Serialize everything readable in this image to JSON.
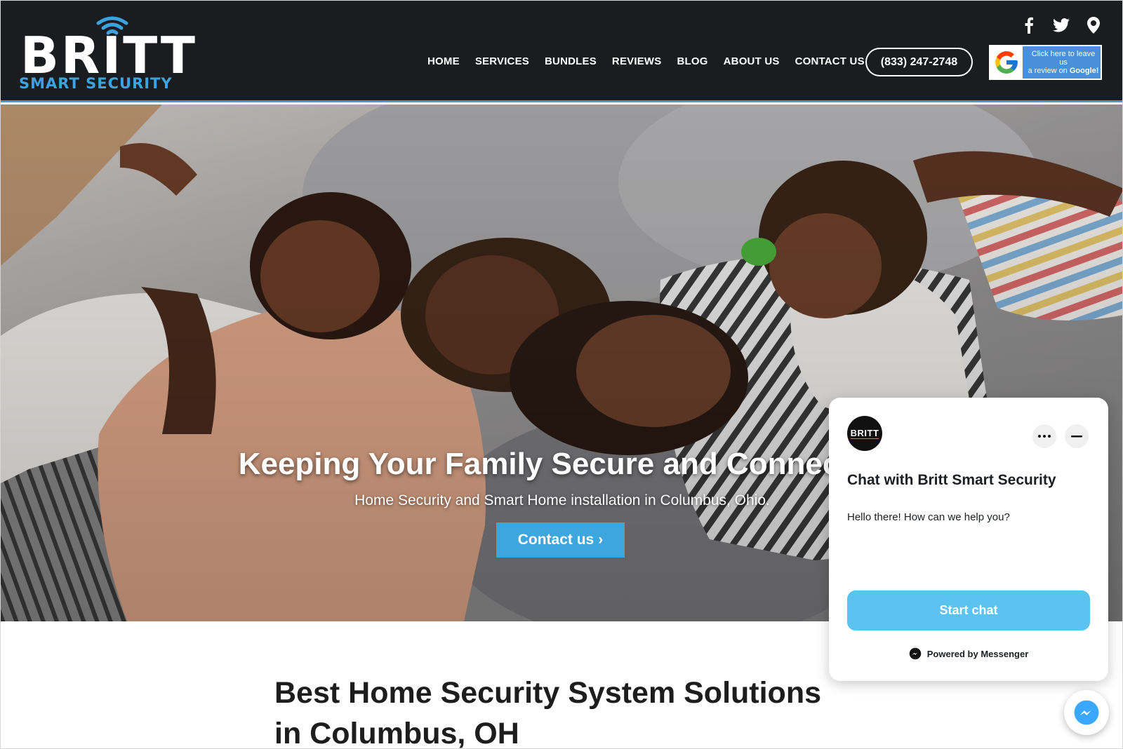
{
  "brand": {
    "name": "BRITT",
    "tagline": "SMART SECURITY",
    "accent": "#3da3de",
    "header_bg": "#1b1c20"
  },
  "social": [
    "facebook-icon",
    "twitter-icon",
    "map-pin-icon"
  ],
  "nav": {
    "items": [
      "HOME",
      "SERVICES",
      "BUNDLES",
      "REVIEWS",
      "BLOG",
      "ABOUT US",
      "CONTACT US"
    ],
    "phone": "(833) 247-2748",
    "google_review": {
      "line1": "Click here to leave us",
      "line2_prefix": "a review on",
      "line2_bold": "Google!"
    }
  },
  "hero": {
    "title": "Keeping Your Family Secure and Connected",
    "subtitle": "Home Security and Smart Home installation in Columbus, Ohio.",
    "cta_label": "Contact us",
    "cta_arrow": "›",
    "cta_color": "#3ca6dd"
  },
  "section": {
    "title_line1": "Best Home Security System Solutions",
    "title_line2": "in Columbus, OH"
  },
  "chat": {
    "avatar_text": "BRITT",
    "title": "Chat with Britt Smart Security",
    "message": "Hello there! How can we help you?",
    "start_label": "Start chat",
    "powered_by": "Powered by Messenger",
    "button_color": "#5bc3f0"
  }
}
